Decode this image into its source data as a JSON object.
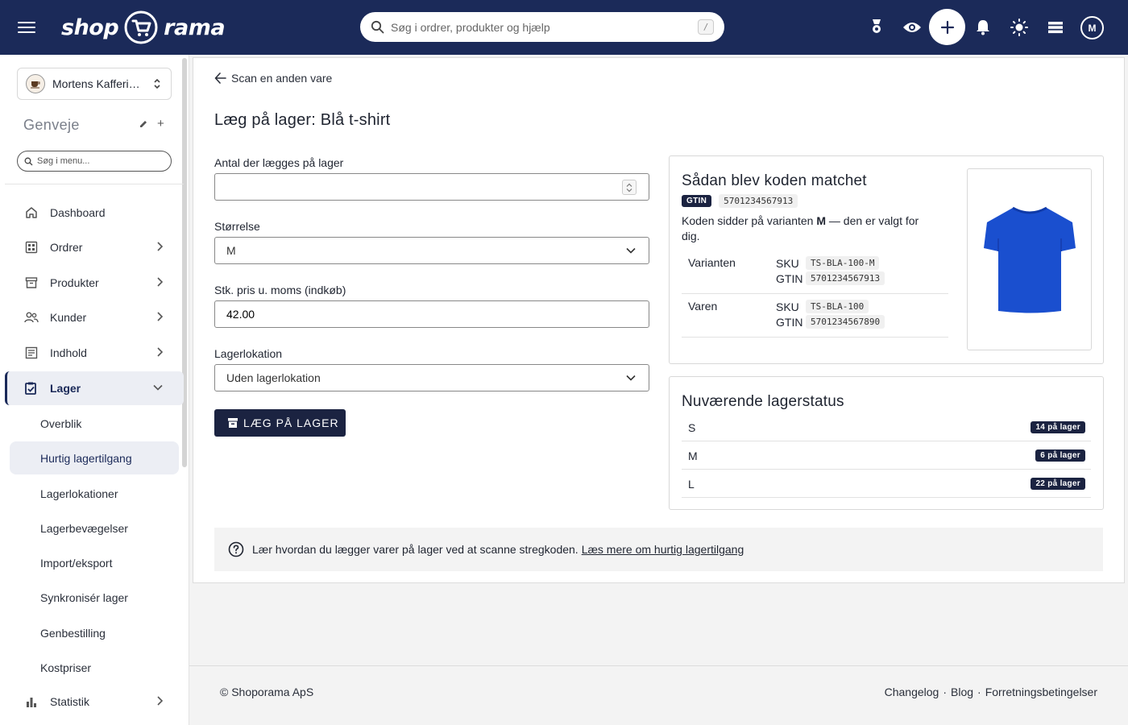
{
  "topbar": {
    "logo_left": "shop",
    "logo_right": "rama",
    "search_placeholder": "Søg i ordrer, produkter og hjælp",
    "search_shortcut": "/",
    "avatar_initial": "M"
  },
  "sidebar": {
    "store_name": "Mortens Kafferi…",
    "shortcuts_title": "Genveje",
    "menu_search_placeholder": "Søg i menu...",
    "items": [
      {
        "label": "Dashboard"
      },
      {
        "label": "Ordrer"
      },
      {
        "label": "Produkter"
      },
      {
        "label": "Kunder"
      },
      {
        "label": "Indhold"
      },
      {
        "label": "Lager"
      },
      {
        "label": "Statistik"
      }
    ],
    "lager_sub": [
      {
        "label": "Overblik"
      },
      {
        "label": "Hurtig lagertilgang"
      },
      {
        "label": "Lagerlokationer"
      },
      {
        "label": "Lagerbevægelser"
      },
      {
        "label": "Import/eksport"
      },
      {
        "label": "Synkronisér lager"
      },
      {
        "label": "Genbestilling"
      },
      {
        "label": "Kostpriser"
      }
    ]
  },
  "main": {
    "back_label": "Scan en anden vare",
    "title": "Læg på lager: Blå t-shirt",
    "form": {
      "quantity_label": "Antal der lægges på lager",
      "quantity_value": "",
      "size_label": "Størrelse",
      "size_value": "M",
      "price_label": "Stk. pris u. moms (indkøb)",
      "price_value": "42.00",
      "location_label": "Lagerlokation",
      "location_value": "Uden lagerlokation",
      "submit_label": "LÆG PÅ LAGER"
    },
    "match": {
      "title": "Sådan blev koden matchet",
      "badge": "GTIN",
      "code": "5701234567913",
      "desc_before": "Koden sidder på varianten ",
      "desc_variant": "M",
      "desc_after": " — den er valgt for dig.",
      "rows": [
        {
          "label": "Varianten",
          "sku_key": "SKU",
          "sku": "TS-BLA-100-M",
          "gtin_key": "GTIN",
          "gtin": "5701234567913"
        },
        {
          "label": "Varen",
          "sku_key": "SKU",
          "sku": "TS-BLA-100",
          "gtin_key": "GTIN",
          "gtin": "5701234567890"
        }
      ],
      "image_color": "#1a4fcf"
    },
    "stock": {
      "title": "Nuværende lagerstatus",
      "rows": [
        {
          "size": "S",
          "qty": "14 på lager"
        },
        {
          "size": "M",
          "qty": "6 på lager"
        },
        {
          "size": "L",
          "qty": "22 på lager"
        }
      ]
    },
    "help": {
      "text": "Lær hvordan du lægger varer på lager ved at scanne stregkoden.",
      "link": "Læs mere om hurtig lagertilgang"
    }
  },
  "footer": {
    "copyright": "© Shoporama ApS",
    "links": [
      "Changelog",
      "Blog",
      "Forretningsbetingelser"
    ],
    "separator": "·"
  },
  "colors": {
    "navy": "#1b2a59",
    "button_dark": "#1b2341",
    "tshirt_blue": "#1a4fcf"
  }
}
